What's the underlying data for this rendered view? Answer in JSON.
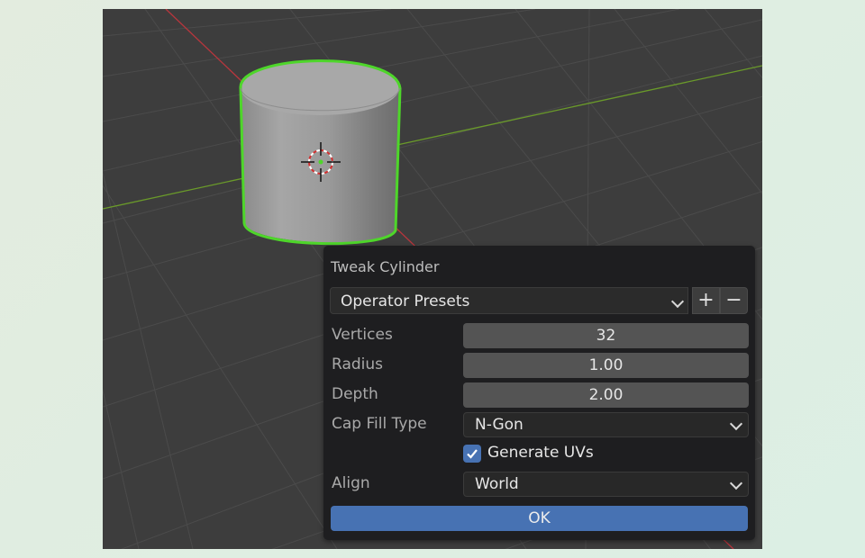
{
  "panel": {
    "title": "Tweak Cylinder",
    "presets": {
      "label": "Operator Presets",
      "add_symbol": "+",
      "remove_symbol": "−"
    },
    "properties": {
      "vertices": {
        "label": "Vertices",
        "value": "32"
      },
      "radius": {
        "label": "Radius",
        "value": "1.00"
      },
      "depth": {
        "label": "Depth",
        "value": "2.00"
      },
      "cap_fill_type": {
        "label": "Cap Fill Type",
        "value": "N-Gon"
      },
      "generate_uvs": {
        "label": "Generate UVs",
        "checked": true
      },
      "align": {
        "label": "Align",
        "value": "World"
      }
    },
    "ok_label": "OK"
  },
  "viewport": {
    "object": "cylinder",
    "selected": true,
    "outline_color": "#4ed62a",
    "x_axis_color": "#b8363d",
    "y_axis_color": "#6a9a2a"
  },
  "colors": {
    "accent": "#4772b3",
    "panel_bg": "#1e1e20",
    "viewport_bg": "#3d3d3d"
  }
}
